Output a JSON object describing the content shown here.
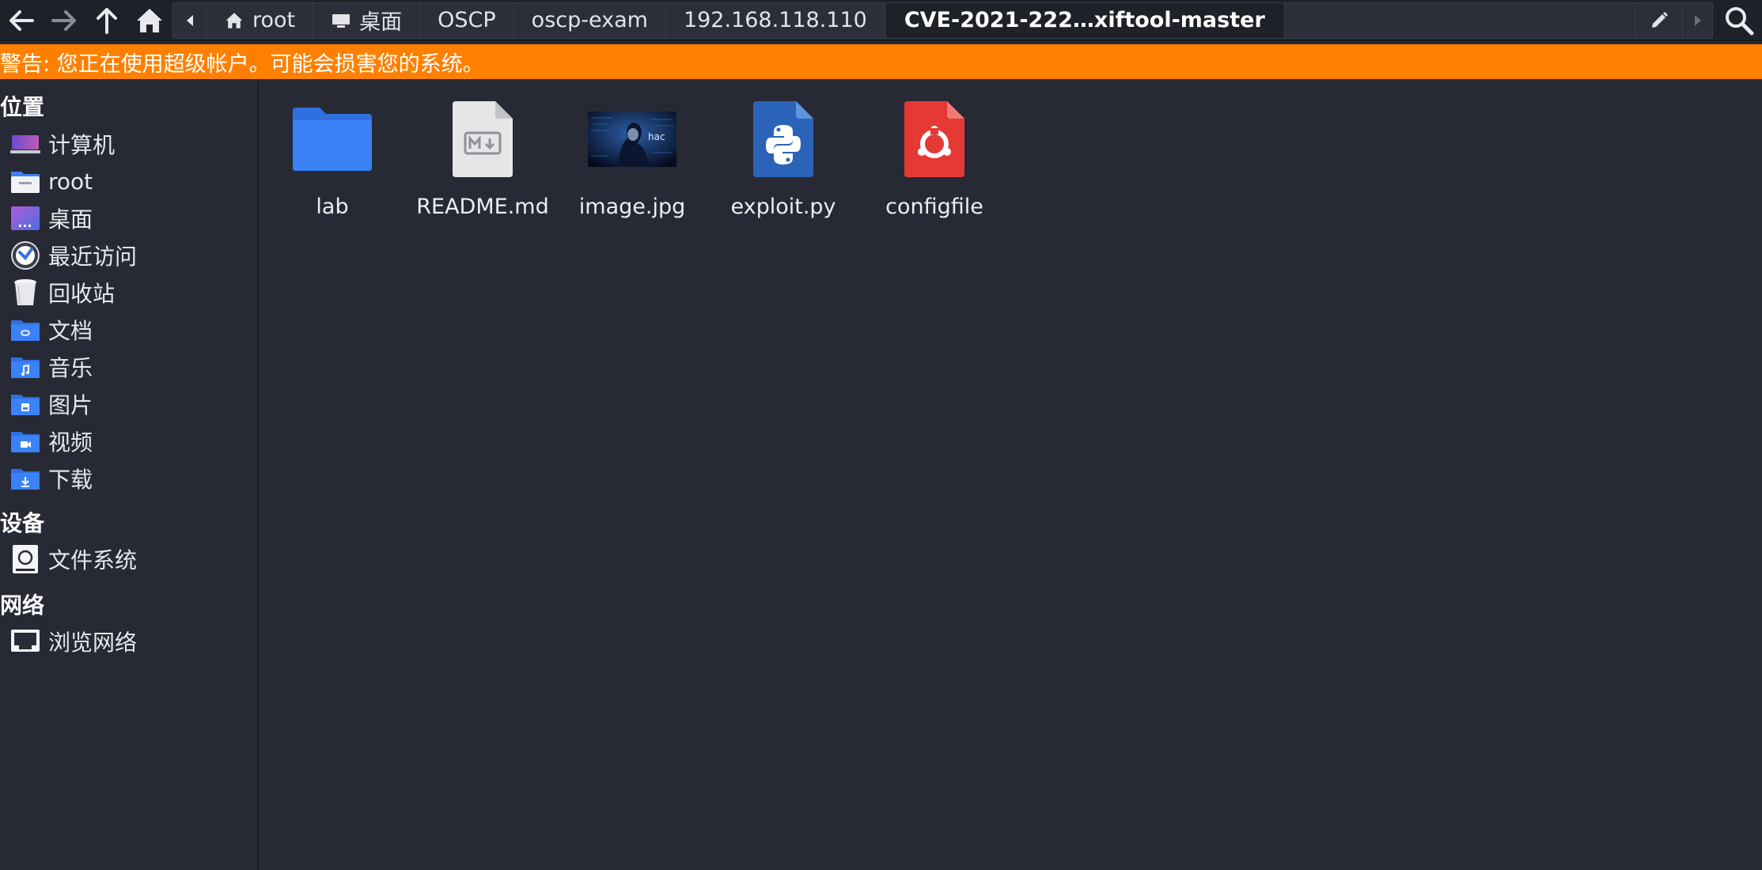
{
  "toolbar": {
    "back_icon": "arrow-left-icon",
    "forward_icon": "arrow-right-icon",
    "up_icon": "arrow-up-icon",
    "home_icon": "home-icon",
    "breadcrumbs": [
      "root",
      "桌面",
      "OSCP",
      "oscp-exam",
      "192.168.118.110",
      "CVE-2021-222…xiftool-master"
    ],
    "active_crumb": "CVE-2021-222…xiftool-master",
    "edit_icon": "pencil-icon",
    "search_icon": "search-icon"
  },
  "warning": {
    "text": "警告: 您正在使用超级帐户。可能会损害您的系统。",
    "color": "#ff8000"
  },
  "sidebar": {
    "places_title": "位置",
    "places": [
      {
        "label": "计算机",
        "icon": "computer-icon"
      },
      {
        "label": "root",
        "icon": "home-folder-icon"
      },
      {
        "label": "桌面",
        "icon": "desktop-icon"
      },
      {
        "label": "最近访问",
        "icon": "clock-icon"
      },
      {
        "label": "回收站",
        "icon": "trash-icon"
      },
      {
        "label": "文档",
        "icon": "documents-folder-icon"
      },
      {
        "label": "音乐",
        "icon": "music-folder-icon"
      },
      {
        "label": "图片",
        "icon": "pictures-folder-icon"
      },
      {
        "label": "视频",
        "icon": "videos-folder-icon"
      },
      {
        "label": "下载",
        "icon": "downloads-folder-icon"
      }
    ],
    "devices_title": "设备",
    "devices": [
      {
        "label": "文件系统",
        "icon": "harddisk-icon"
      }
    ],
    "network_title": "网络",
    "network": [
      {
        "label": "浏览网络",
        "icon": "network-icon"
      }
    ]
  },
  "files": [
    {
      "name": "lab",
      "icon": "folder-icon"
    },
    {
      "name": "README.md",
      "icon": "markdown-file-icon"
    },
    {
      "name": "image.jpg",
      "icon": "image-thumbnail-icon",
      "thumb_text": "hac"
    },
    {
      "name": "exploit.py",
      "icon": "python-file-icon"
    },
    {
      "name": "configfile",
      "icon": "config-file-icon"
    }
  ],
  "colors": {
    "background": "#272a35",
    "toolbar": "#1f2129",
    "folder_blue": "#3b82f6",
    "python_blue": "#2b63b8",
    "config_red": "#e53935"
  }
}
